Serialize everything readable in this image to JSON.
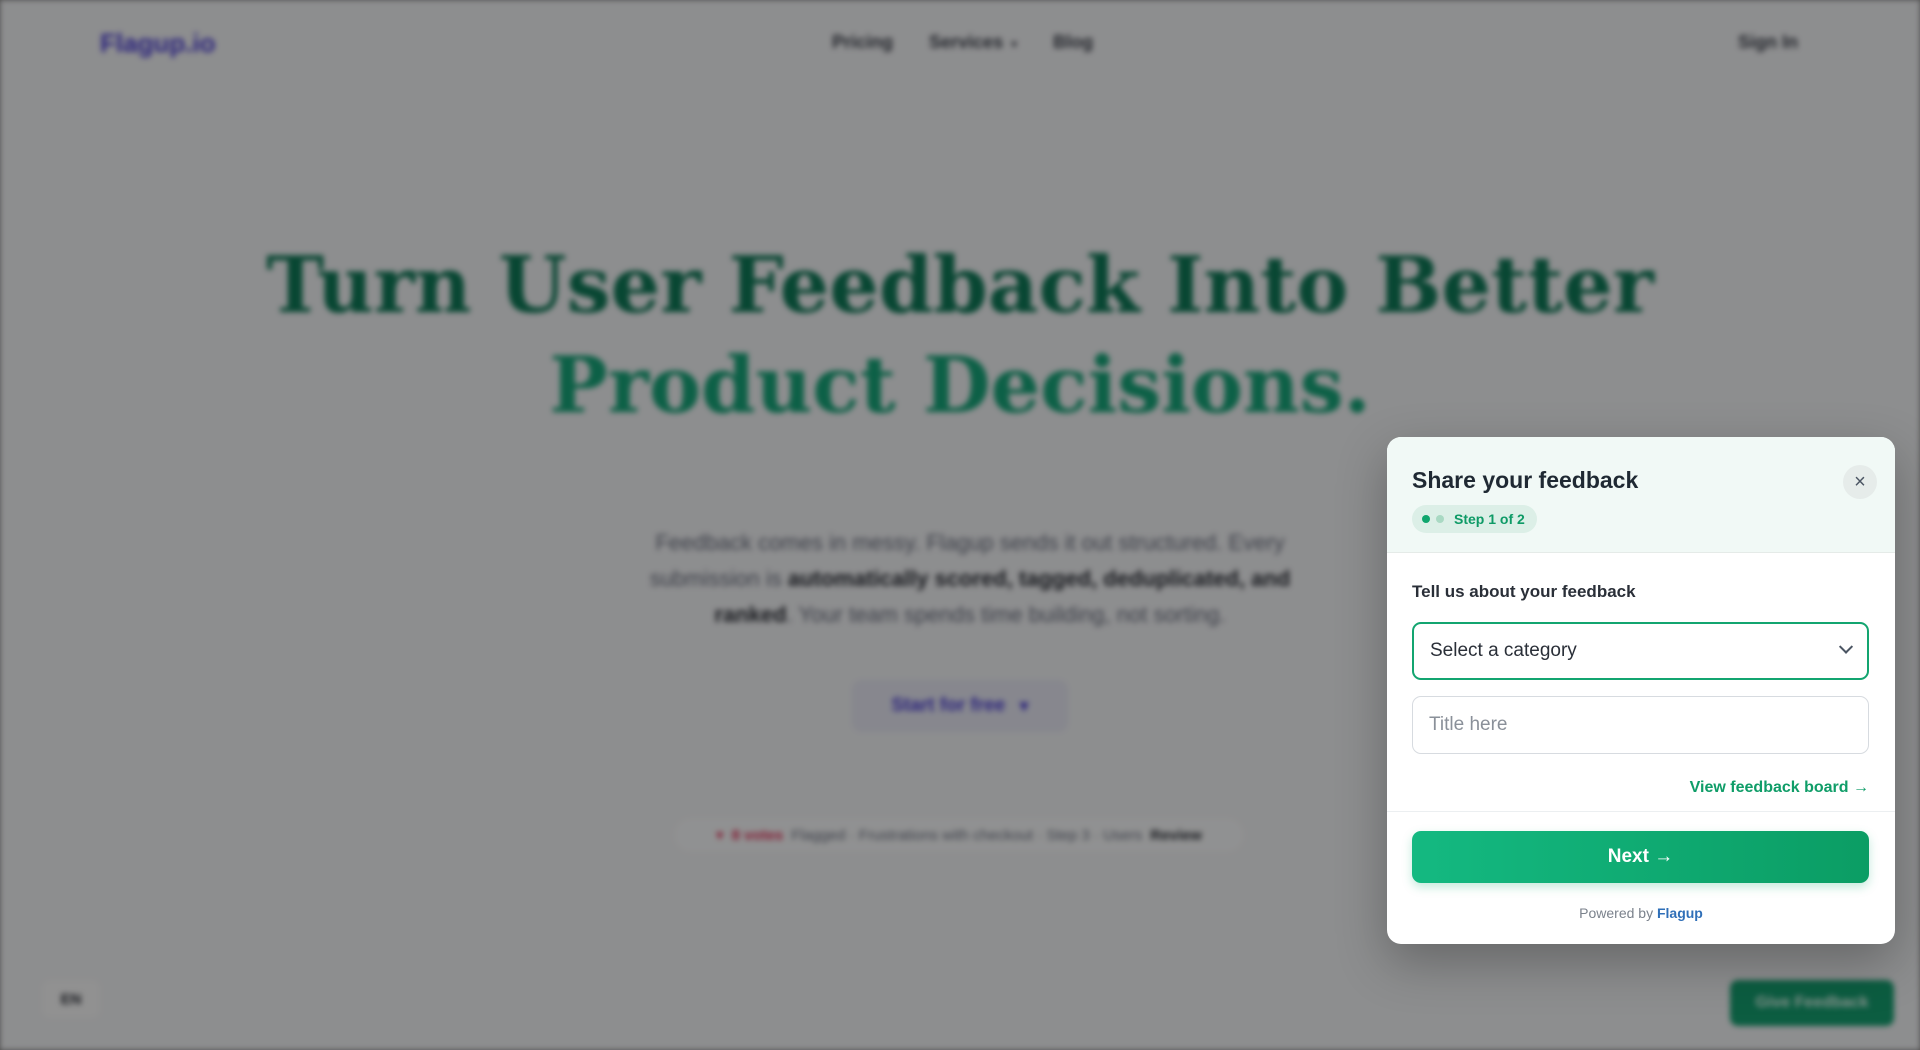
{
  "background": {
    "logo": "Flagup.io",
    "nav": [
      "Pricing",
      "Services",
      "Blog"
    ],
    "sign_in": "Sign In",
    "hero_line1": "Turn User Feedback Into Better",
    "hero_line2": "Product Decisions.",
    "sub_1": "Feedback comes in messy. Flagup sends it out structured. Every submission is ",
    "sub_bold_1": "automatically scored, tagged, deduplicated, and ranked",
    "sub_2": ". Your team spends time building, not sorting.",
    "cta": "Start for free",
    "badge_votes": "8 votes",
    "badge_text": "Flagged · Frustrations with checkout · Step 3 · Users",
    "badge_strong": "Review",
    "lang": "EN",
    "give_feedback": "Give Feedback"
  },
  "widget": {
    "title": "Share your feedback",
    "close_glyph": "×",
    "step": "Step 1 of 2",
    "label": "Tell us about your feedback",
    "category_value": "Select a category",
    "title_placeholder": "Title here",
    "board_link": "View feedback board →",
    "next": "Next →",
    "powered_by": "Powered by",
    "brand": "Flagup"
  },
  "colors": {
    "accent": "#10a66e",
    "brand_link": "#2f6fb8",
    "hero_green": "#0f7a58"
  }
}
